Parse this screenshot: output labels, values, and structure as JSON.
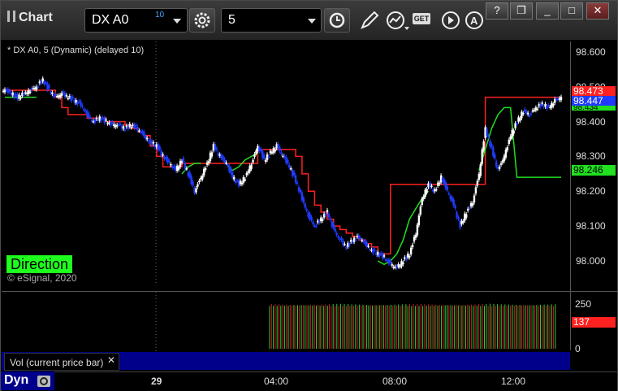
{
  "window": {
    "title": "Chart",
    "minimize": "_",
    "restore": "❐",
    "maximize": "□",
    "close": "✕",
    "help": "?"
  },
  "toolbar": {
    "symbol": "DX A0",
    "symbol_badge": "10",
    "interval": "5",
    "icons": [
      "settings-icon",
      "clock-icon",
      "pencil-icon",
      "line-chart-icon",
      "get-icon",
      "play-icon",
      "alert-icon"
    ],
    "get_label": "GET"
  },
  "chart": {
    "study_label": "* DX A0, 5 (Dynamic) (delayed 10)",
    "direction_label": "Direction",
    "copyright": "© eSignal, 2020",
    "price_labels": {
      "red": "98.473",
      "blue": "98.447",
      "green_top": "98.434",
      "green": "98.246"
    },
    "colors": {
      "up": "#ffffff",
      "down": "#1f3bff",
      "red_line": "#ff2020",
      "green_line": "#20e020",
      "label_blue": "#1f3bff",
      "label_red": "#ff2020",
      "label_green": "#20e020"
    }
  },
  "chart_data": {
    "type": "candlestick",
    "y_ticks": [
      "98.600",
      "98.500",
      "98.400",
      "98.300",
      "98.200",
      "98.100",
      "98.000"
    ],
    "ylim": [
      97.93,
      98.63
    ],
    "x_ticks": [
      "29",
      "04:00",
      "08:00",
      "12:00"
    ],
    "series": [
      {
        "name": "price",
        "points": [
          98.49,
          98.48,
          98.47,
          98.48,
          98.49,
          98.5,
          98.52,
          98.49,
          98.47,
          98.48,
          98.47,
          98.46,
          98.45,
          98.42,
          98.4,
          98.41,
          98.4,
          98.39,
          98.39,
          98.38,
          98.39,
          98.38,
          98.36,
          98.34,
          98.33,
          98.3,
          98.28,
          98.26,
          98.29,
          98.25,
          98.2,
          98.24,
          98.28,
          98.33,
          98.3,
          98.28,
          98.24,
          98.22,
          98.24,
          98.28,
          98.33,
          98.29,
          98.31,
          98.33,
          98.3,
          98.27,
          98.23,
          98.18,
          98.13,
          98.1,
          98.12,
          98.14,
          98.09,
          98.06,
          98.04,
          98.06,
          98.07,
          98.05,
          98.03,
          98.02,
          98.01,
          97.99,
          97.98,
          98.0,
          98.02,
          98.08,
          98.18,
          98.22,
          98.2,
          98.24,
          98.2,
          98.16,
          98.1,
          98.14,
          98.17,
          98.25,
          98.38,
          98.32,
          98.26,
          98.3,
          98.36,
          98.4,
          98.43,
          98.42,
          98.44,
          98.45,
          98.44,
          98.46,
          98.47
        ]
      },
      {
        "name": "red_line",
        "points": [
          98.49,
          98.49,
          98.49,
          98.49,
          98.49,
          98.49,
          98.49,
          98.49,
          98.47,
          98.44,
          98.42,
          98.42,
          98.42,
          98.41,
          98.41,
          98.41,
          98.4,
          98.4,
          98.4,
          98.39,
          98.38,
          98.37,
          98.36,
          98.33,
          98.3,
          98.27,
          98.27,
          98.27,
          98.28,
          98.28,
          98.28,
          98.28,
          98.28,
          98.28,
          98.28,
          98.28,
          98.28,
          98.28,
          98.28,
          98.28,
          98.32,
          98.32,
          98.32,
          98.32,
          98.32,
          98.32,
          98.3,
          98.25,
          98.2,
          98.16,
          98.14,
          98.12,
          98.1,
          98.09,
          98.08,
          98.07,
          98.06,
          98.05,
          98.04,
          98.02,
          98.02,
          98.22,
          98.22,
          98.22,
          98.22,
          98.22,
          98.22,
          98.22,
          98.22,
          98.22,
          98.22,
          98.22,
          98.22,
          98.22,
          98.22,
          98.22,
          98.47,
          98.47,
          98.47,
          98.47,
          98.47,
          98.47,
          98.47,
          98.47,
          98.47,
          98.47,
          98.47,
          98.47,
          98.47
        ]
      },
      {
        "name": "green_line",
        "points": [
          98.47,
          98.47,
          98.47,
          98.47,
          98.47,
          98.47,
          null,
          null,
          null,
          null,
          null,
          null,
          null,
          null,
          null,
          null,
          null,
          null,
          null,
          null,
          null,
          null,
          null,
          null,
          null,
          null,
          null,
          null,
          98.25,
          98.27,
          98.28,
          98.28,
          null,
          null,
          null,
          98.28,
          98.26,
          98.27,
          98.29,
          98.3,
          98.31,
          null,
          null,
          null,
          null,
          null,
          null,
          null,
          null,
          null,
          null,
          null,
          null,
          null,
          null,
          null,
          null,
          null,
          null,
          98.0,
          97.99,
          98.0,
          98.02,
          98.06,
          98.12,
          98.15,
          98.18,
          98.2,
          null,
          null,
          null,
          null,
          null,
          null,
          null,
          98.26,
          98.32,
          98.38,
          98.42,
          98.44,
          98.44,
          98.24,
          98.24,
          98.24,
          98.24,
          98.24,
          98.24,
          98.24,
          98.24
        ]
      }
    ],
    "volume": {
      "ticks": [
        "250",
        "137",
        "0"
      ],
      "ylim": [
        0,
        280
      ],
      "last": "137"
    }
  }
}
